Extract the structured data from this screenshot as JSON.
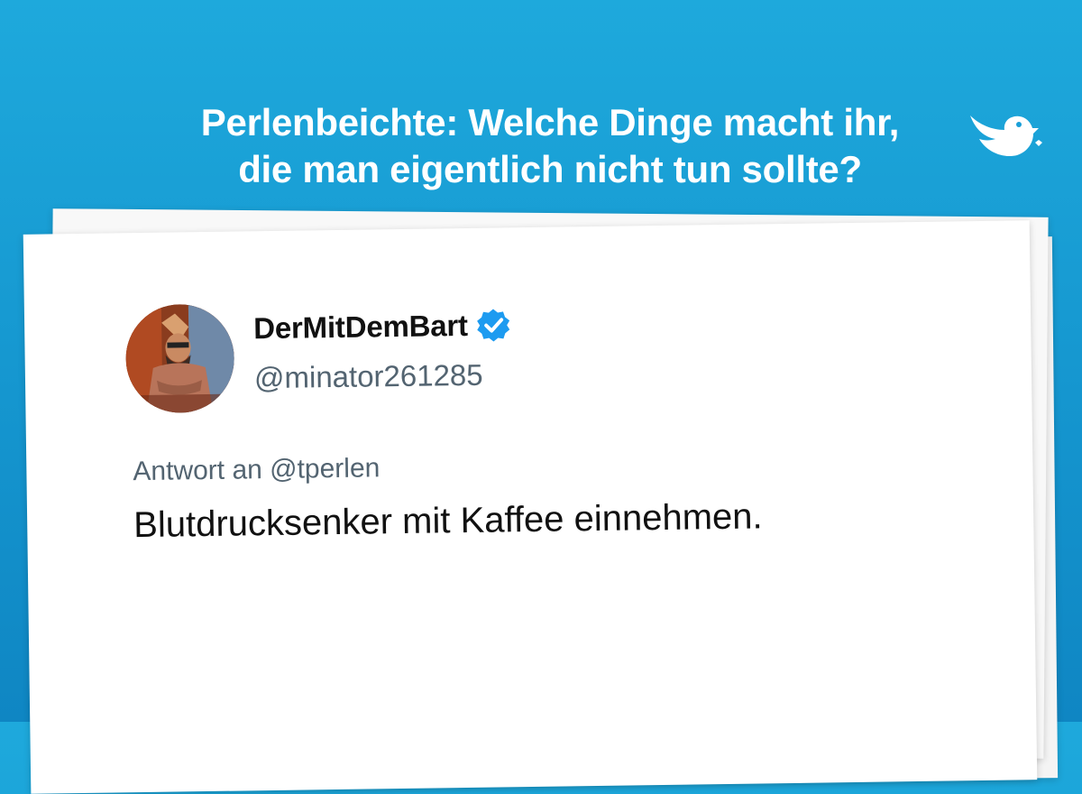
{
  "headline": {
    "line1": "Perlenbeichte: Welche Dinge macht ihr,",
    "line2": "die man eigentlich nicht tun sollte?"
  },
  "brand": {
    "icon": "bird-icon",
    "color": "#ffffff"
  },
  "tweet": {
    "display_name": "DerMitDemBart",
    "handle": "@minator261285",
    "verified": true,
    "verified_color": "#1d9bf0",
    "reply_to": "Antwort an @tperlen",
    "text": "Blutdrucksenker mit Kaffee einnehmen."
  },
  "colors": {
    "background": "#1596cf",
    "paper": "#ffffff",
    "text": "#111111",
    "muted": "#536471"
  }
}
